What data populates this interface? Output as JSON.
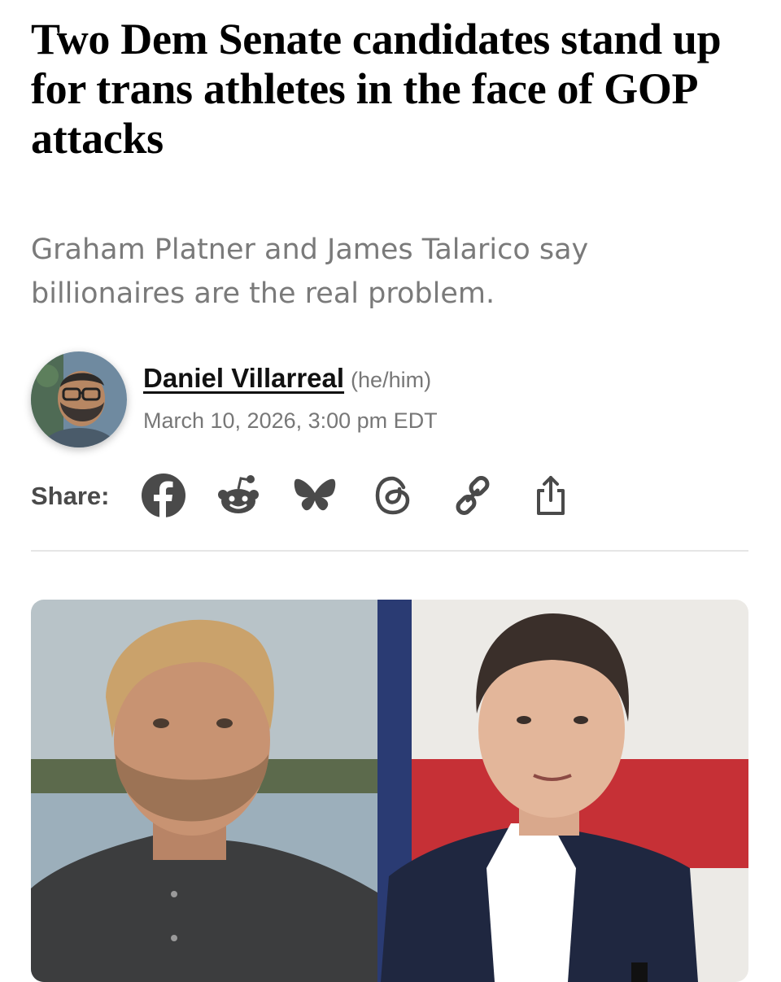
{
  "article": {
    "headline": "Two Dem Senate candidates stand up for trans athletes in the face of GOP attacks",
    "dek": "Graham Platner and James Talarico say billionaires are the real problem."
  },
  "byline": {
    "author": "Daniel Villarreal",
    "pronouns": "(he/him)",
    "date": "March 10, 2026, 3:00 pm EDT"
  },
  "share": {
    "label": "Share:",
    "icons": [
      "facebook-icon",
      "reddit-icon",
      "bluesky-icon",
      "threads-icon",
      "link-icon",
      "share-icon"
    ],
    "icon_color": "#4a4a4a"
  },
  "colors": {
    "headline": "#000000",
    "dek": "#7a7a7a",
    "meta": "#777777"
  }
}
